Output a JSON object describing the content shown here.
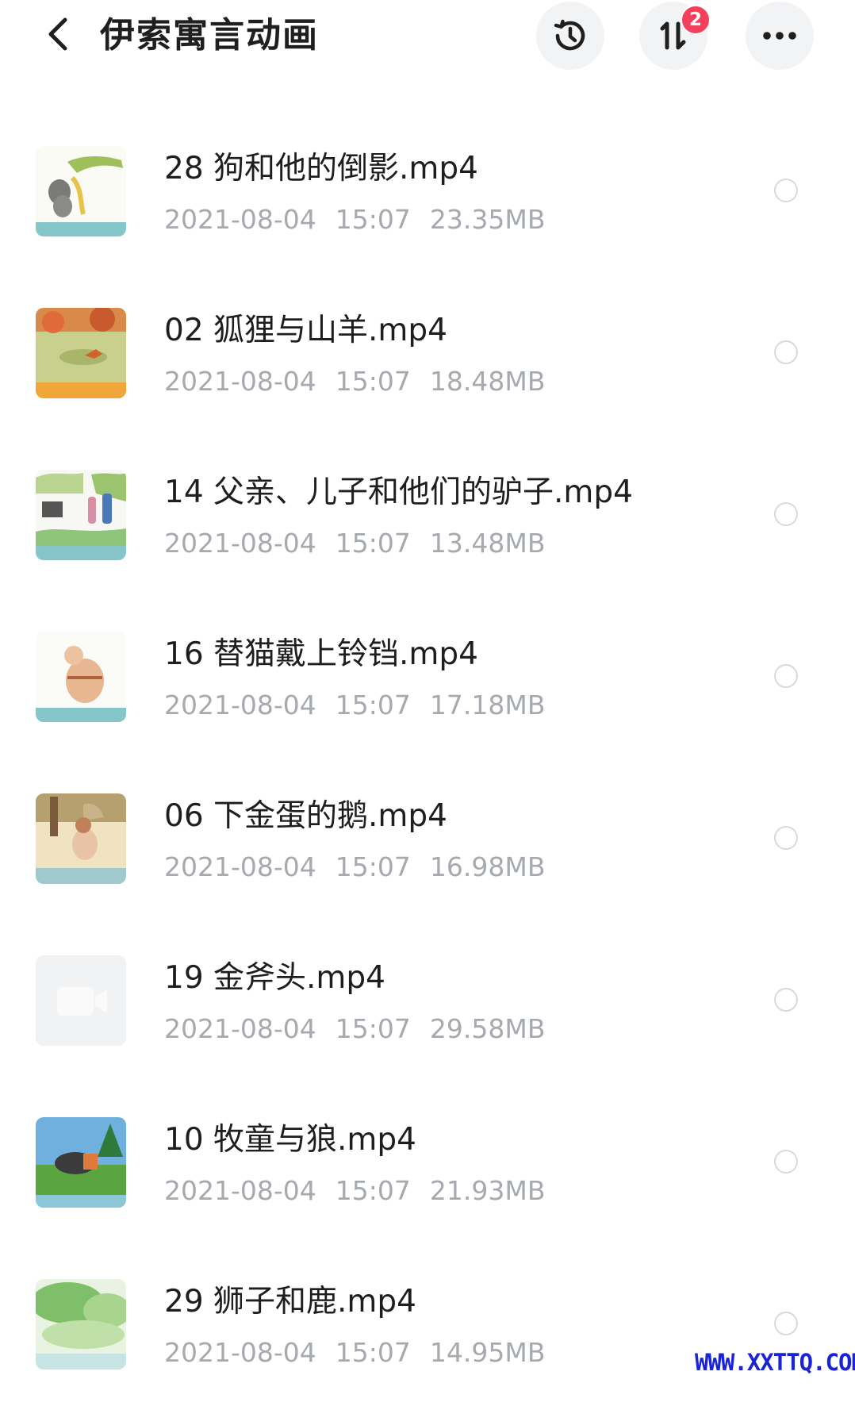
{
  "header": {
    "title": "伊索寓言动画",
    "sort_badge": "2"
  },
  "files": [
    {
      "name": "28 狗和他的倒影.mp4",
      "date": "2021-08-04",
      "time": "15:07",
      "size": "23.35MB",
      "thumb": "dog"
    },
    {
      "name": "02 狐狸与山羊.mp4",
      "date": "2021-08-04",
      "time": "15:07",
      "size": "18.48MB",
      "thumb": "fox"
    },
    {
      "name": "14 父亲、儿子和他们的驴子.mp4",
      "date": "2021-08-04",
      "time": "15:07",
      "size": "13.48MB",
      "thumb": "donkey"
    },
    {
      "name": "16 替猫戴上铃铛.mp4",
      "date": "2021-08-04",
      "time": "15:07",
      "size": "17.18MB",
      "thumb": "cat"
    },
    {
      "name": "06 下金蛋的鹅.mp4",
      "date": "2021-08-04",
      "time": "15:07",
      "size": "16.98MB",
      "thumb": "goose"
    },
    {
      "name": "19 金斧头.mp4",
      "date": "2021-08-04",
      "time": "15:07",
      "size": "29.58MB",
      "thumb": "video-placeholder"
    },
    {
      "name": "10 牧童与狼.mp4",
      "date": "2021-08-04",
      "time": "15:07",
      "size": "21.93MB",
      "thumb": "shepherd"
    },
    {
      "name": "29 狮子和鹿.mp4",
      "date": "2021-08-04",
      "time": "15:07",
      "size": "14.95MB",
      "thumb": "lion"
    }
  ],
  "watermark": "WWW.XXTTQ.COM"
}
